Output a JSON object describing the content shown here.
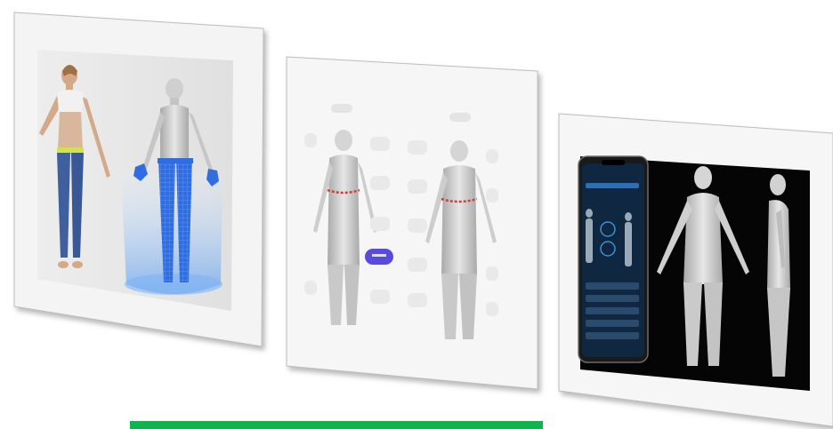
{
  "panels": [
    {
      "name": "panel-scan-photo-vs-model",
      "caption": ""
    },
    {
      "name": "panel-measurement-comparison",
      "caption": ""
    },
    {
      "name": "panel-phone-app-3d-body",
      "caption": ""
    }
  ],
  "colors": {
    "background": "#ffffff",
    "frame": "#f4f4f4",
    "frame_shadow": "#b9b9b9",
    "skin": "#d9b79c",
    "top": "#f1f1f1",
    "leggings": "#3f5f9e",
    "waistband": "#d6e04a",
    "mesh_blue": "#2f6de0",
    "scan_glow": "#7fb4f5",
    "model_gray": "#c9c9c9",
    "measure_line": "#d83a3a",
    "measure_tag": "#5a4be0",
    "phone_bg": "#0f2740",
    "dark_panel": "#050505",
    "accent_bar": "#11b24f"
  },
  "icons": [
    "phone-icon"
  ]
}
